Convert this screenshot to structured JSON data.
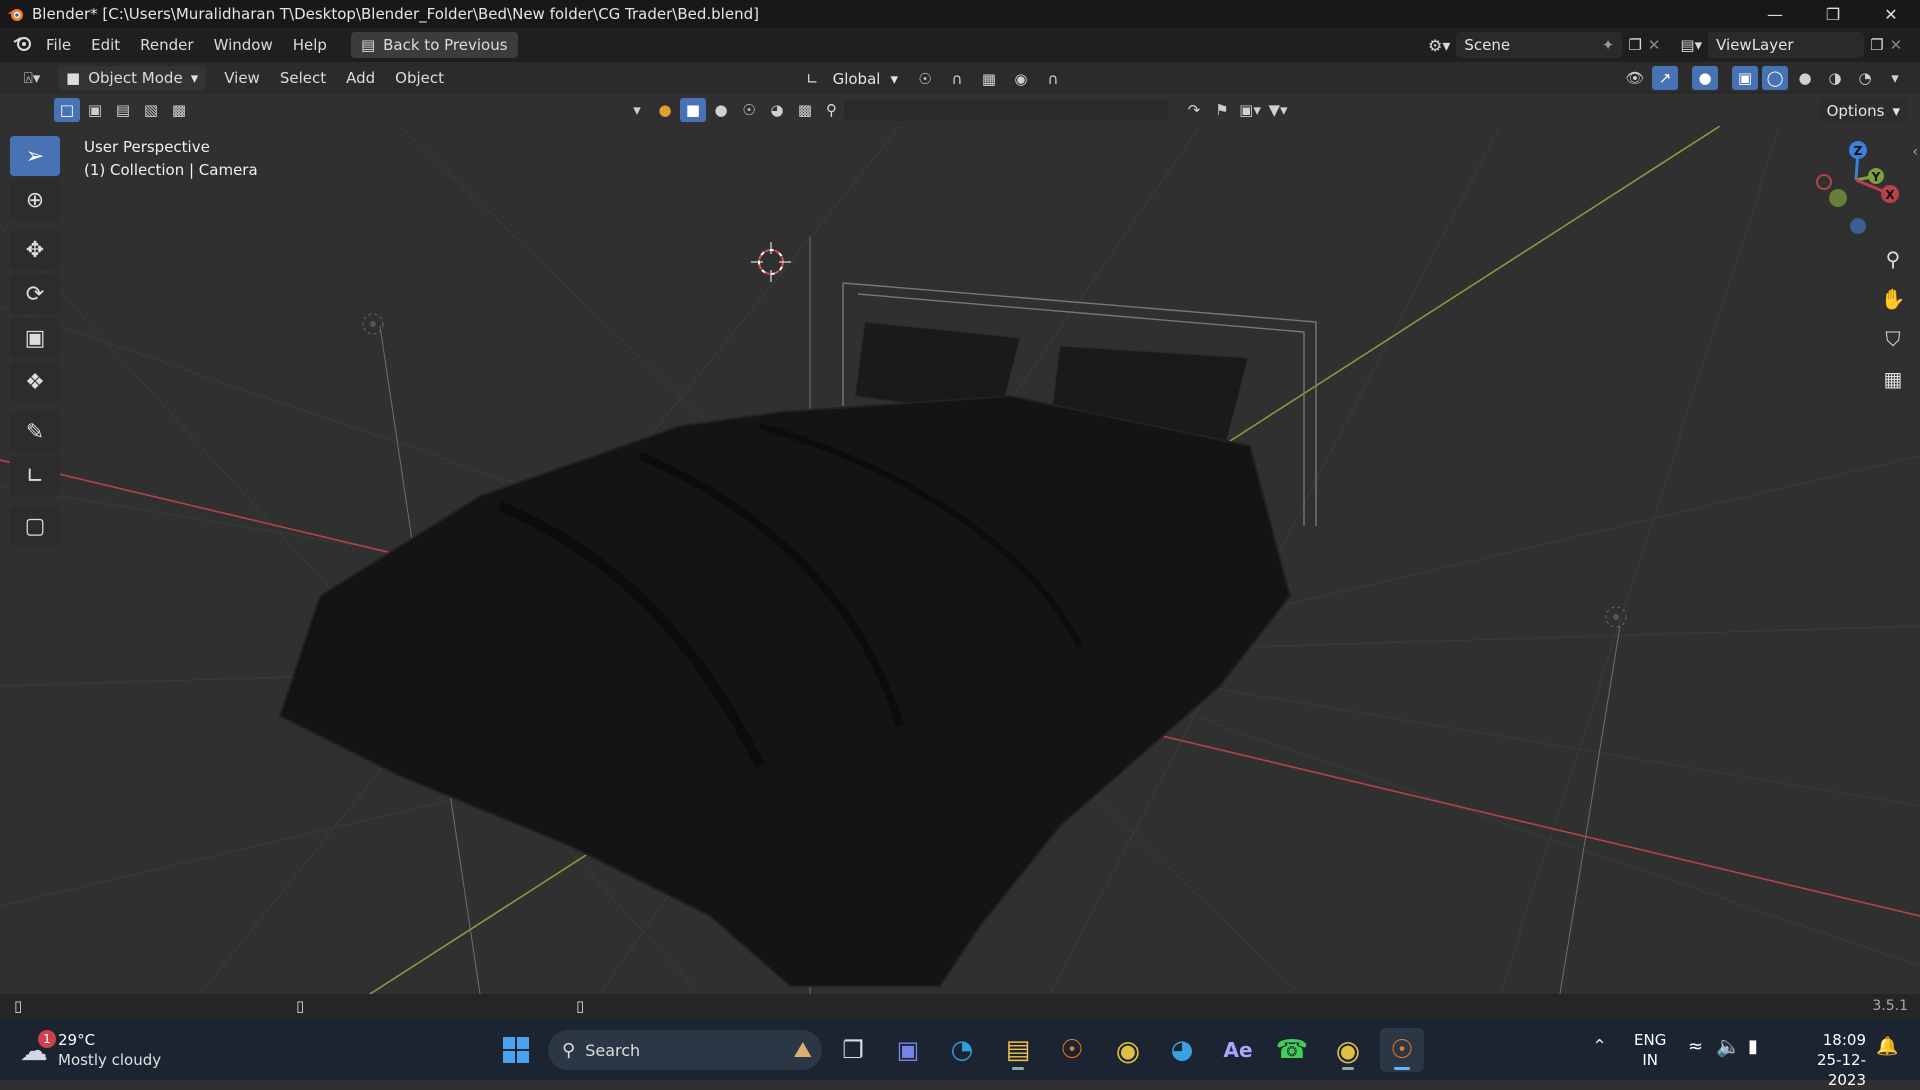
{
  "window": {
    "title": "Blender* [C:\\Users\\Muralidharan T\\Desktop\\Blender_Folder\\Bed\\New folder\\CG Trader\\Bed.blend]",
    "controls": [
      "minimize-icon",
      "restore-icon",
      "close-icon"
    ]
  },
  "menubar": {
    "items": [
      "File",
      "Edit",
      "Render",
      "Window",
      "Help"
    ],
    "back_button": "Back to Previous",
    "scene_label": "Scene",
    "viewlayer_label": "ViewLayer"
  },
  "header3d": {
    "mode": "Object Mode",
    "menus": [
      "View",
      "Select",
      "Add",
      "Object"
    ],
    "transform_orientation": "Global"
  },
  "header2": {
    "options_label": "Options"
  },
  "viewport": {
    "perspective_label": "User Perspective",
    "collection_label": "(1) Collection | Camera",
    "gizmo_axes": [
      "Z",
      "Y",
      "X"
    ],
    "tools": [
      "select-box-icon",
      "cursor-icon",
      "move-icon",
      "rotate-icon",
      "scale-icon",
      "transform-icon",
      "annotate-icon",
      "measure-icon",
      "add-cube-icon"
    ],
    "nav": [
      "zoom-icon",
      "pan-hand-icon",
      "camera-view-icon",
      "ortho-grid-icon"
    ]
  },
  "statusbar": {
    "version": "3.5.1"
  },
  "taskbar": {
    "weather_temp": "29°C",
    "weather_desc": "Mostly cloudy",
    "weather_badge": "1",
    "search_label": "Search",
    "lang_top": "ENG",
    "lang_bottom": "IN",
    "time": "18:09",
    "date": "25-12-2023"
  },
  "colors": {
    "accent": "#4772b3",
    "x_axis": "#b8404c",
    "y_axis": "#7ea03a",
    "z_axis": "#3f7fd8",
    "taskbar_bg": "#1b2430"
  }
}
